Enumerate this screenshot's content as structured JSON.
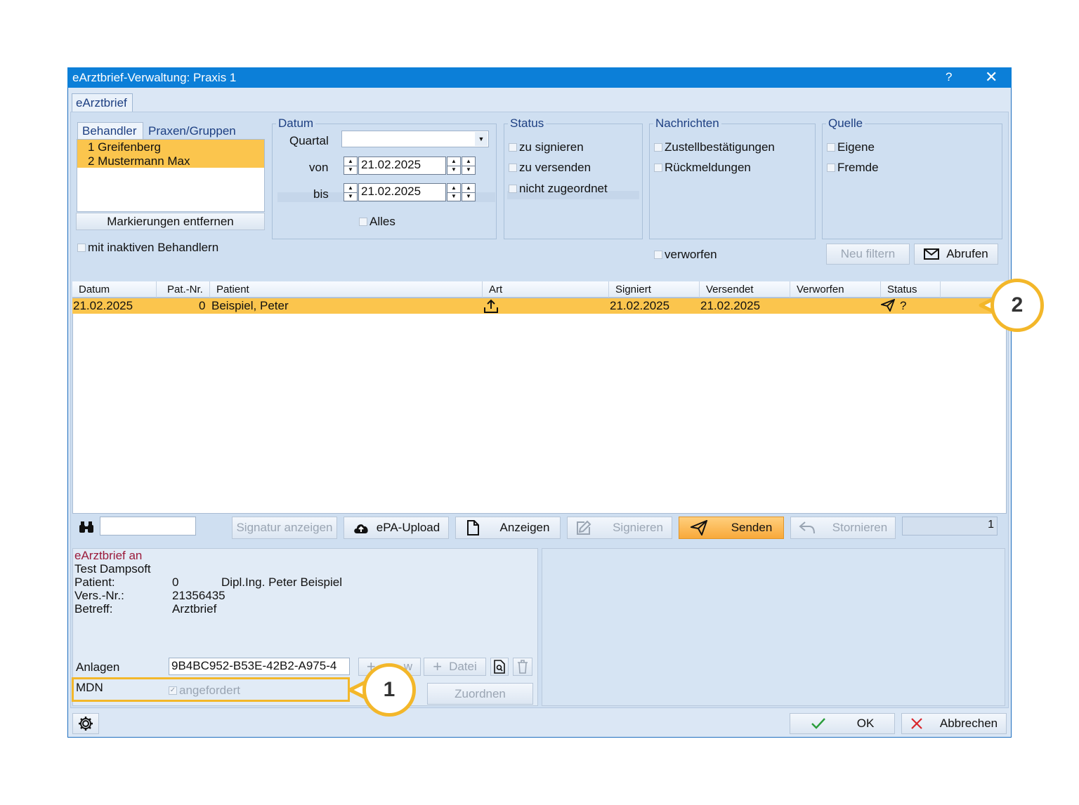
{
  "window": {
    "title": "eArztbrief-Verwaltung: Praxis 1",
    "help": "?",
    "close": "✕"
  },
  "main_tab": "eArztbrief",
  "doctors": {
    "tabs": [
      "Behandler",
      "Praxen/Gruppen"
    ],
    "items": [
      "1 Greifenberg",
      "2 Mustermann Max"
    ],
    "clear_button": "Markierungen entfernen",
    "inactive_label": "mit inaktiven Behandlern"
  },
  "datum": {
    "title": "Datum",
    "quartal_label": "Quartal",
    "quartal_value": "",
    "von_label": "von",
    "von_value": "21.02.2025",
    "bis_label": "bis",
    "bis_value": "21.02.2025",
    "alles_label": "Alles"
  },
  "status": {
    "title": "Status",
    "options": [
      "zu signieren",
      "zu versenden",
      "nicht zugeordnet"
    ]
  },
  "nachrichten": {
    "title": "Nachrichten",
    "options": [
      "Zustellbestätigungen",
      "Rückmeldungen"
    ],
    "verworfen_label": "verworfen"
  },
  "quelle": {
    "title": "Quelle",
    "options": [
      "Eigene",
      "Fremde"
    ]
  },
  "filter_buttons": {
    "neu_filtern": "Neu filtern",
    "abrufen": "Abrufen"
  },
  "table": {
    "headers": [
      "Datum",
      "Pat.-Nr.",
      "Patient",
      "Art",
      "Signiert",
      "Versendet",
      "Verworfen",
      "Status"
    ],
    "rows": [
      {
        "datum": "21.02.2025",
        "patnr": "0",
        "patient": "Beispiel, Peter",
        "art_icon": "upload-icon",
        "signiert": "21.02.2025",
        "versendet": "21.02.2025",
        "verworfen": "",
        "status_icons": [
          "send-icon"
        ],
        "status_text": "?"
      }
    ]
  },
  "toolbar": {
    "search_value": "",
    "signatur_anzeigen": "Signatur anzeigen",
    "epa_upload": "ePA-Upload",
    "anzeigen": "Anzeigen",
    "signieren": "Signieren",
    "senden": "Senden",
    "stornieren": "Stornieren",
    "count": "1"
  },
  "info": {
    "heading": "eArztbrief an",
    "recipient": "Test Dampsoft",
    "patient_label": "Patient:",
    "patient_nr": "0",
    "patient_name": "Dipl.Ing. Peter Beispiel",
    "vers_label": "Vers.-Nr.:",
    "vers_value": "21356435",
    "betreff_label": "Betreff:",
    "betreff_value": "Arztbrief",
    "anlagen_label": "Anlagen",
    "anlagen_value": "9B4BC952-B53E-42B2-A975-4",
    "anlagen_add_partial": "w",
    "datei_button": "Datei",
    "mdn_label": "MDN",
    "angefordert_label": "angefordert",
    "zuordnen_button": "Zuordnen"
  },
  "footer": {
    "ok": "OK",
    "abbrechen": "Abbrechen"
  },
  "callouts": [
    "1",
    "2"
  ],
  "colors": {
    "titlebar": "#0c7fd8",
    "selection": "#fbc54d",
    "callout": "#f3b72a",
    "senden": "#f8a93a",
    "ok_check": "#2a9d3b",
    "cancel_x": "#d9262b",
    "heading_red": "#9b1b3b"
  }
}
